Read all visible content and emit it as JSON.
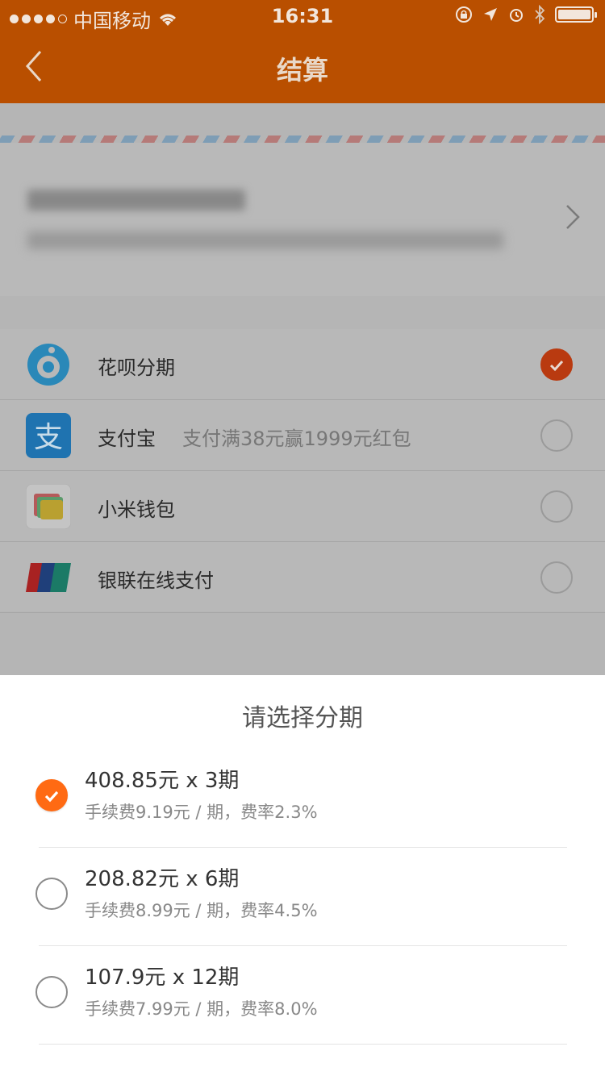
{
  "status_bar": {
    "carrier": "中国移动",
    "time": "16:31"
  },
  "nav": {
    "title": "结算"
  },
  "payment_methods": [
    {
      "name": "花呗分期",
      "promo": "",
      "selected": true,
      "icon": "huabei-icon"
    },
    {
      "name": "支付宝",
      "promo": "支付满38元赢1999元红包",
      "selected": false,
      "icon": "alipay-icon"
    },
    {
      "name": "小米钱包",
      "promo": "",
      "selected": false,
      "icon": "mi-wallet-icon"
    },
    {
      "name": "银联在线支付",
      "promo": "",
      "selected": false,
      "icon": "unionpay-icon"
    }
  ],
  "installment_sheet": {
    "title": "请选择分期",
    "options": [
      {
        "main": "408.85元 x 3期",
        "sub": "手续费9.19元 / 期，费率2.3%",
        "selected": true
      },
      {
        "main": "208.82元 x 6期",
        "sub": "手续费8.99元 / 期，费率4.5%",
        "selected": false
      },
      {
        "main": "107.9元 x 12期",
        "sub": "手续费7.99元 / 期，费率8.0%",
        "selected": false
      }
    ]
  },
  "colors": {
    "nav_bg_dimmed": "#b94f00",
    "accent": "#ff6a13",
    "overlay_gray": "#b5b5b5"
  }
}
